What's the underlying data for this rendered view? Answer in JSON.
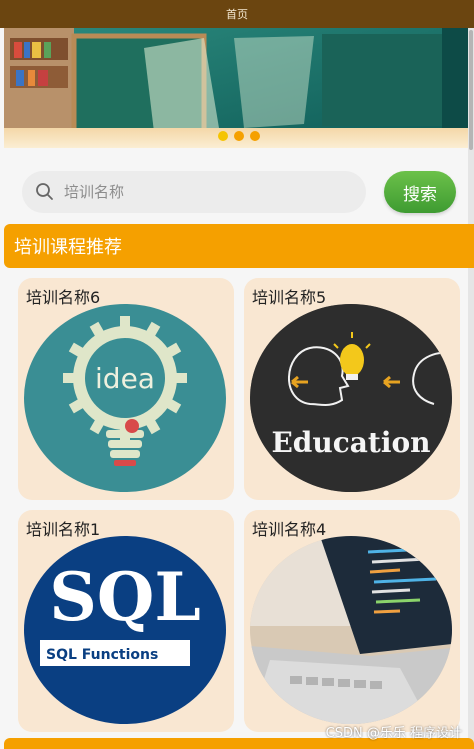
{
  "header": {
    "title": "首页"
  },
  "carousel": {
    "dots": [
      {
        "color": "#f5c400",
        "active": true
      },
      {
        "color": "#f5a000",
        "active": false
      },
      {
        "color": "#f5a000",
        "active": false
      }
    ]
  },
  "search": {
    "placeholder": "培训名称",
    "button_label": "搜索",
    "icon": "search-icon"
  },
  "section": {
    "title": "培训课程推荐"
  },
  "courses": [
    {
      "title": "培训名称6",
      "image": "idea-lightbulb-gear"
    },
    {
      "title": "培训名称5",
      "image": "education-chalkboard"
    },
    {
      "title": "培训名称1",
      "image": "sql-functions",
      "image_text": "SQL",
      "image_subtext": "SQL Functions"
    },
    {
      "title": "培训名称4",
      "image": "laptop-code"
    }
  ],
  "watermark": "CSDN @乐乐 程序设计",
  "colors": {
    "accent": "#f5a000",
    "brand_dark": "#6b4510",
    "button_green": "#4caf3a",
    "card_bg": "#f9e7d2"
  }
}
